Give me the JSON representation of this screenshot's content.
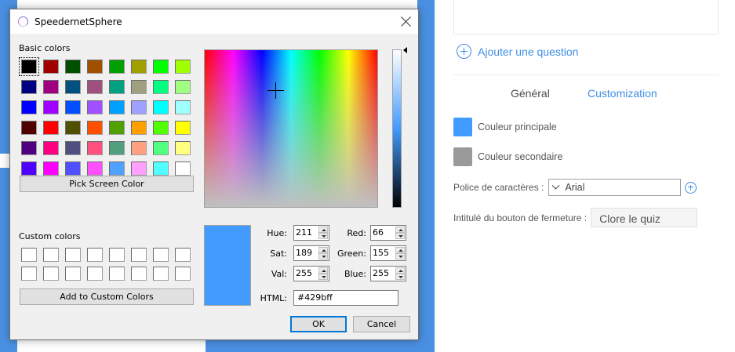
{
  "background": {
    "add_question_label": "Ajouter une question",
    "tabs": [
      {
        "label": "Général",
        "active": false
      },
      {
        "label": "Customization",
        "active": true
      }
    ],
    "primary_color": {
      "label": "Couleur principale",
      "color": "#429bff"
    },
    "secondary_color": {
      "label": "Couleur secondaire",
      "color": "#9a9a9a"
    },
    "font": {
      "label": "Police de caractères :",
      "value": "Arial"
    },
    "close_button": {
      "label": "Intitulé du bouton de fermeture :",
      "value": "Clore le quiz"
    }
  },
  "dialog": {
    "title": "SpeedernetSphere",
    "basic_colors_label": "Basic colors",
    "basic_colors": [
      "#000000",
      "#a00000",
      "#005000",
      "#a05000",
      "#00a000",
      "#a0a000",
      "#00ff00",
      "#a0ff00",
      "#000080",
      "#a00080",
      "#005080",
      "#a05080",
      "#00a080",
      "#a0a080",
      "#00ff80",
      "#a0ff80",
      "#0000ff",
      "#a000ff",
      "#0050ff",
      "#a050ff",
      "#00a0ff",
      "#a0a0ff",
      "#00ffff",
      "#a0ffff",
      "#500000",
      "#ff0000",
      "#505000",
      "#ff5000",
      "#50a000",
      "#ffa000",
      "#50ff00",
      "#ffff00",
      "#500080",
      "#ff0080",
      "#505080",
      "#ff5080",
      "#50a080",
      "#ffa080",
      "#50ff80",
      "#ffff80",
      "#5000ff",
      "#ff00ff",
      "#5050ff",
      "#ff50ff",
      "#50a0ff",
      "#ffa0ff",
      "#50ffff",
      "#ffffff"
    ],
    "selected_basic_index": 0,
    "pick_screen_label": "Pick Screen Color",
    "custom_colors_label": "Custom colors",
    "custom_colors": [
      "#ffffff",
      "#ffffff",
      "#ffffff",
      "#ffffff",
      "#ffffff",
      "#ffffff",
      "#ffffff",
      "#ffffff",
      "#ffffff",
      "#ffffff",
      "#ffffff",
      "#ffffff",
      "#ffffff",
      "#ffffff",
      "#ffffff",
      "#ffffff"
    ],
    "add_custom_label": "Add to Custom Colors",
    "current_color": "#429bff",
    "fields": {
      "hue": {
        "label": "Hue:",
        "value": "211"
      },
      "sat": {
        "label": "Sat:",
        "value": "189"
      },
      "val": {
        "label": "Val:",
        "value": "255"
      },
      "red": {
        "label": "Red:",
        "value": "66"
      },
      "green": {
        "label": "Green:",
        "value": "155"
      },
      "blue": {
        "label": "Blue:",
        "value": "255"
      },
      "html": {
        "label": "HTML:",
        "value": "#429bff"
      }
    },
    "ok_label": "OK",
    "cancel_label": "Cancel"
  }
}
